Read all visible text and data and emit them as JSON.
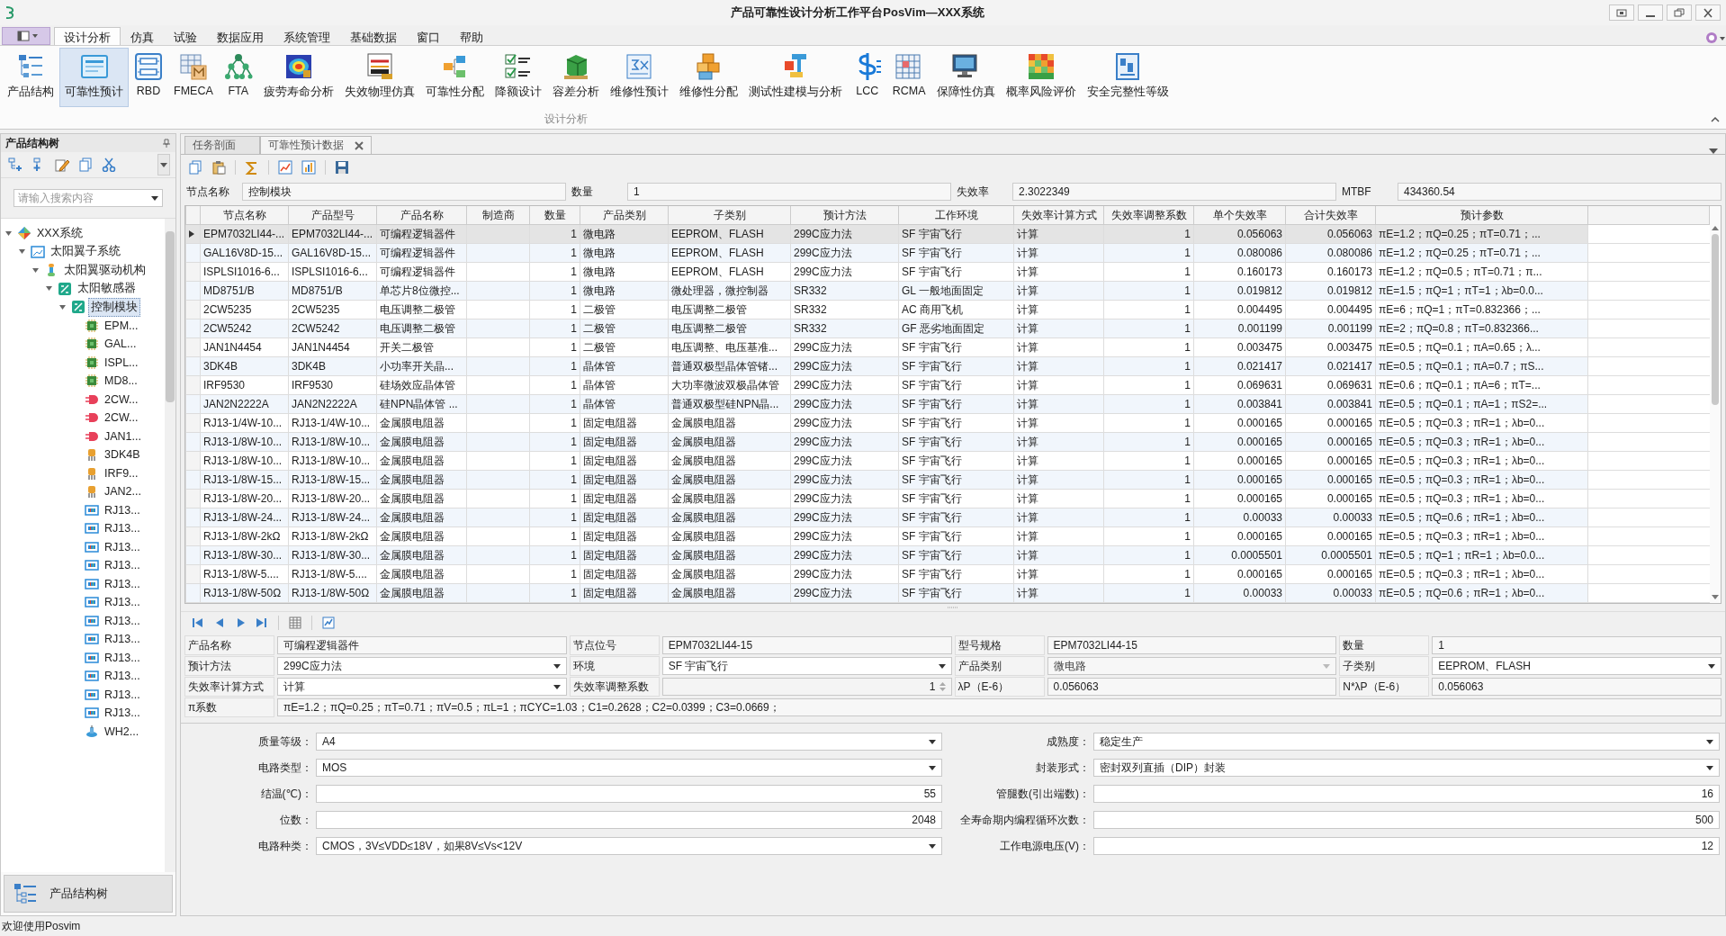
{
  "window": {
    "title": "产品可靠性设计分析工作平台PosVim—XXX系统"
  },
  "menu_tabs": [
    {
      "label": "设计分析",
      "selected": true
    },
    {
      "label": "仿真",
      "selected": false
    },
    {
      "label": "试验",
      "selected": false
    },
    {
      "label": "数据应用",
      "selected": false
    },
    {
      "label": "系统管理",
      "selected": false
    },
    {
      "label": "基础数据",
      "selected": false
    },
    {
      "label": "窗口",
      "selected": false
    },
    {
      "label": "帮助",
      "selected": false
    }
  ],
  "ribbon": {
    "group_label": "设计分析",
    "items": [
      {
        "label": "产品结构",
        "selected": false
      },
      {
        "label": "可靠性预计",
        "selected": true
      },
      {
        "label": "RBD",
        "selected": false
      },
      {
        "label": "FMECA",
        "selected": false
      },
      {
        "label": "FTA",
        "selected": false
      },
      {
        "label": "疲劳寿命分析",
        "selected": false
      },
      {
        "label": "失效物理仿真",
        "selected": false
      },
      {
        "label": "可靠性分配",
        "selected": false
      },
      {
        "label": "降额设计",
        "selected": false
      },
      {
        "label": "容差分析",
        "selected": false
      },
      {
        "label": "维修性预计",
        "selected": false
      },
      {
        "label": "维修性分配",
        "selected": false
      },
      {
        "label": "测试性建模与分析",
        "selected": false
      },
      {
        "label": "LCC",
        "selected": false
      },
      {
        "label": "RCMA",
        "selected": false
      },
      {
        "label": "保障性仿真",
        "selected": false
      },
      {
        "label": "概率风险评价",
        "selected": false
      },
      {
        "label": "安全完整性等级",
        "selected": false
      }
    ]
  },
  "tree_panel": {
    "title": "产品结构树",
    "search": {
      "placeholder": "请输入搜索内容"
    },
    "footer_button": "产品结构树",
    "tree": [
      {
        "label": "XXX系统",
        "kind": "system",
        "expanded": true,
        "selected": false,
        "children": [
          {
            "label": "太阳翼子系统",
            "kind": "subsystem",
            "expanded": true,
            "selected": false,
            "children": [
              {
                "label": "太阳翼驱动机构",
                "kind": "mechanism",
                "expanded": true,
                "selected": false,
                "children": [
                  {
                    "label": "太阳敏感器",
                    "kind": "sensor",
                    "expanded": true,
                    "selected": false,
                    "children": [
                      {
                        "label": "控制模块",
                        "kind": "module",
                        "expanded": true,
                        "selected": true,
                        "children": [
                          {
                            "label": "EPM...",
                            "kind": "chip",
                            "selected": false
                          },
                          {
                            "label": "GAL...",
                            "kind": "chip",
                            "selected": false
                          },
                          {
                            "label": "ISPL...",
                            "kind": "chip",
                            "selected": false
                          },
                          {
                            "label": "MD8...",
                            "kind": "chip",
                            "selected": false
                          },
                          {
                            "label": "2CW...",
                            "kind": "diode",
                            "selected": false
                          },
                          {
                            "label": "2CW...",
                            "kind": "diode",
                            "selected": false
                          },
                          {
                            "label": "JAN1...",
                            "kind": "diode",
                            "selected": false
                          },
                          {
                            "label": "3DK4B",
                            "kind": "transistor",
                            "selected": false
                          },
                          {
                            "label": "IRF9...",
                            "kind": "transistor",
                            "selected": false
                          },
                          {
                            "label": "JAN2...",
                            "kind": "transistor",
                            "selected": false
                          },
                          {
                            "label": "RJ13...",
                            "kind": "resistor",
                            "selected": false
                          },
                          {
                            "label": "RJ13...",
                            "kind": "resistor",
                            "selected": false
                          },
                          {
                            "label": "RJ13...",
                            "kind": "resistor",
                            "selected": false
                          },
                          {
                            "label": "RJ13...",
                            "kind": "resistor",
                            "selected": false
                          },
                          {
                            "label": "RJ13...",
                            "kind": "resistor",
                            "selected": false
                          },
                          {
                            "label": "RJ13...",
                            "kind": "resistor",
                            "selected": false
                          },
                          {
                            "label": "RJ13...",
                            "kind": "resistor",
                            "selected": false
                          },
                          {
                            "label": "RJ13...",
                            "kind": "resistor",
                            "selected": false
                          },
                          {
                            "label": "RJ13...",
                            "kind": "resistor",
                            "selected": false
                          },
                          {
                            "label": "RJ13...",
                            "kind": "resistor",
                            "selected": false
                          },
                          {
                            "label": "RJ13...",
                            "kind": "resistor",
                            "selected": false
                          },
                          {
                            "label": "RJ13...",
                            "kind": "resistor",
                            "selected": false
                          },
                          {
                            "label": "WH2...",
                            "kind": "potentiometer",
                            "selected": false
                          }
                        ]
                      }
                    ]
                  }
                ]
              }
            ]
          }
        ]
      }
    ]
  },
  "doc_tabs": [
    {
      "label": "任务剖面",
      "selected": false,
      "closable": false
    },
    {
      "label": "可靠性预计数据",
      "selected": true,
      "closable": true
    }
  ],
  "summary": [
    {
      "label": "节点名称",
      "value": "控制模块"
    },
    {
      "label": "数量",
      "value": "1"
    },
    {
      "label": "失效率",
      "value": "2.3022349"
    },
    {
      "label": "MTBF",
      "value": "434360.54"
    }
  ],
  "table": {
    "columns": [
      "节点名称",
      "产品型号",
      "产品名称",
      "制造商",
      "数量",
      "产品类别",
      "子类别",
      "预计方法",
      "工作环境",
      "失效率计算方式",
      "失效率调整系数",
      "单个失效率",
      "合计失效率",
      "预计参数"
    ],
    "rows": [
      {
        "selected": true,
        "cells": [
          "EPM7032LI44-...",
          "EPM7032LI44-...",
          "可编程逻辑器件",
          null,
          "1",
          "微电路",
          "EEPROM、FLASH",
          "299C应力法",
          "SF  宇宙飞行",
          "计算",
          "1",
          "0.056063",
          "0.056063",
          "πE=1.2；πQ=0.25；πT=0.71；..."
        ]
      },
      {
        "selected": false,
        "cells": [
          "GAL16V8D-15...",
          "GAL16V8D-15...",
          "可编程逻辑器件",
          null,
          "1",
          "微电路",
          "EEPROM、FLASH",
          "299C应力法",
          "SF  宇宙飞行",
          "计算",
          "1",
          "0.080086",
          "0.080086",
          "πE=1.2；πQ=0.25；πT=0.71；..."
        ]
      },
      {
        "selected": false,
        "cells": [
          "ISPLSI1016-6...",
          "ISPLSI1016-6...",
          "可编程逻辑器件",
          null,
          "1",
          "微电路",
          "EEPROM、FLASH",
          "299C应力法",
          "SF  宇宙飞行",
          "计算",
          "1",
          "0.160173",
          "0.160173",
          "πE=1.2；πQ=0.5；πT=0.71；π..."
        ]
      },
      {
        "selected": false,
        "cells": [
          "MD8751/B",
          "MD8751/B",
          "单芯片8位微控...",
          null,
          "1",
          "微电路",
          "微处理器，微控制器",
          "SR332",
          "GL  一般地面固定",
          "计算",
          "1",
          "0.019812",
          "0.019812",
          "πE=1.5；πQ=1；πT=1；λb=0.0..."
        ]
      },
      {
        "selected": false,
        "cells": [
          "2CW5235",
          "2CW5235",
          "电压调整二极管",
          null,
          "1",
          "二极管",
          "电压调整二极管",
          "SR332",
          "AC  商用飞机",
          "计算",
          "1",
          "0.004495",
          "0.004495",
          "πE=6；πQ=1；πT=0.832366；..."
        ]
      },
      {
        "selected": false,
        "cells": [
          "2CW5242",
          "2CW5242",
          "电压调整二极管",
          null,
          "1",
          "二极管",
          "电压调整二极管",
          "SR332",
          "GF  恶劣地面固定",
          "计算",
          "1",
          "0.001199",
          "0.001199",
          "πE=2；πQ=0.8；πT=0.832366..."
        ]
      },
      {
        "selected": false,
        "cells": [
          "JAN1N4454",
          "JAN1N4454",
          "开关二极管",
          null,
          "1",
          "二极管",
          "电压调整、电压基准...",
          "299C应力法",
          "SF  宇宙飞行",
          "计算",
          "1",
          "0.003475",
          "0.003475",
          "πE=0.5；πQ=0.1；πA=0.65；λ..."
        ]
      },
      {
        "selected": false,
        "cells": [
          "3DK4B",
          "3DK4B",
          "小功率开关晶...",
          null,
          "1",
          "晶体管",
          "普通双极型晶体管锗...",
          "299C应力法",
          "SF  宇宙飞行",
          "计算",
          "1",
          "0.021417",
          "0.021417",
          "πE=0.5；πQ=0.1；πA=0.7；πS..."
        ]
      },
      {
        "selected": false,
        "cells": [
          "IRF9530",
          "IRF9530",
          "硅场效应晶体管",
          null,
          "1",
          "晶体管",
          "大功率微波双极晶体管",
          "299C应力法",
          "SF  宇宙飞行",
          "计算",
          "1",
          "0.069631",
          "0.069631",
          "πE=0.6；πQ=0.1；πA=6；πT=..."
        ]
      },
      {
        "selected": false,
        "cells": [
          "JAN2N2222A",
          "JAN2N2222A",
          "硅NPN晶体管 ...",
          null,
          "1",
          "晶体管",
          "普通双极型硅NPN晶...",
          "299C应力法",
          "SF  宇宙飞行",
          "计算",
          "1",
          "0.003841",
          "0.003841",
          "πE=0.5；πQ=0.1；πA=1；πS2=..."
        ]
      },
      {
        "selected": false,
        "cells": [
          "RJ13-1/4W-10...",
          "RJ13-1/4W-10...",
          "金属膜电阻器",
          null,
          "1",
          "固定电阻器",
          "金属膜电阻器",
          "299C应力法",
          "SF  宇宙飞行",
          "计算",
          "1",
          "0.000165",
          "0.000165",
          "πE=0.5；πQ=0.3；πR=1；λb=0..."
        ]
      },
      {
        "selected": false,
        "cells": [
          "RJ13-1/8W-10...",
          "RJ13-1/8W-10...",
          "金属膜电阻器",
          null,
          "1",
          "固定电阻器",
          "金属膜电阻器",
          "299C应力法",
          "SF  宇宙飞行",
          "计算",
          "1",
          "0.000165",
          "0.000165",
          "πE=0.5；πQ=0.3；πR=1；λb=0..."
        ]
      },
      {
        "selected": false,
        "cells": [
          "RJ13-1/8W-10...",
          "RJ13-1/8W-10...",
          "金属膜电阻器",
          null,
          "1",
          "固定电阻器",
          "金属膜电阻器",
          "299C应力法",
          "SF  宇宙飞行",
          "计算",
          "1",
          "0.000165",
          "0.000165",
          "πE=0.5；πQ=0.3；πR=1；λb=0..."
        ]
      },
      {
        "selected": false,
        "cells": [
          "RJ13-1/8W-15...",
          "RJ13-1/8W-15...",
          "金属膜电阻器",
          null,
          "1",
          "固定电阻器",
          "金属膜电阻器",
          "299C应力法",
          "SF  宇宙飞行",
          "计算",
          "1",
          "0.000165",
          "0.000165",
          "πE=0.5；πQ=0.3；πR=1；λb=0..."
        ]
      },
      {
        "selected": false,
        "cells": [
          "RJ13-1/8W-20...",
          "RJ13-1/8W-20...",
          "金属膜电阻器",
          null,
          "1",
          "固定电阻器",
          "金属膜电阻器",
          "299C应力法",
          "SF  宇宙飞行",
          "计算",
          "1",
          "0.000165",
          "0.000165",
          "πE=0.5；πQ=0.3；πR=1；λb=0..."
        ]
      },
      {
        "selected": false,
        "cells": [
          "RJ13-1/8W-24...",
          "RJ13-1/8W-24...",
          "金属膜电阻器",
          null,
          "1",
          "固定电阻器",
          "金属膜电阻器",
          "299C应力法",
          "SF  宇宙飞行",
          "计算",
          "1",
          "0.00033",
          "0.00033",
          "πE=0.5；πQ=0.6；πR=1；λb=0..."
        ]
      },
      {
        "selected": false,
        "cells": [
          "RJ13-1/8W-2kΩ",
          "RJ13-1/8W-2kΩ",
          "金属膜电阻器",
          null,
          "1",
          "固定电阻器",
          "金属膜电阻器",
          "299C应力法",
          "SF  宇宙飞行",
          "计算",
          "1",
          "0.000165",
          "0.000165",
          "πE=0.5；πQ=0.3；πR=1；λb=0..."
        ]
      },
      {
        "selected": false,
        "cells": [
          "RJ13-1/8W-30...",
          "RJ13-1/8W-30...",
          "金属膜电阻器",
          null,
          "1",
          "固定电阻器",
          "金属膜电阻器",
          "299C应力法",
          "SF  宇宙飞行",
          "计算",
          "1",
          "0.0005501",
          "0.0005501",
          "πE=0.5；πQ=1；πR=1；λb=0.0..."
        ]
      },
      {
        "selected": false,
        "cells": [
          "RJ13-1/8W-5....",
          "RJ13-1/8W-5....",
          "金属膜电阻器",
          null,
          "1",
          "固定电阻器",
          "金属膜电阻器",
          "299C应力法",
          "SF  宇宙飞行",
          "计算",
          "1",
          "0.000165",
          "0.000165",
          "πE=0.5；πQ=0.3；πR=1；λb=0..."
        ]
      },
      {
        "selected": false,
        "cells": [
          "RJ13-1/8W-50Ω",
          "RJ13-1/8W-50Ω",
          "金属膜电阻器",
          null,
          "1",
          "固定电阻器",
          "金属膜电阻器",
          "299C应力法",
          "SF  宇宙飞行",
          "计算",
          "1",
          "0.00033",
          "0.00033",
          "πE=0.5；πQ=0.6；πR=1；λb=0..."
        ]
      }
    ]
  },
  "detail_form": {
    "rows": [
      [
        {
          "label": "产品名称",
          "value": "可编程逻辑器件",
          "kind": "text"
        },
        {
          "label": "节点位号",
          "value": "EPM7032LI44-15",
          "kind": "text"
        },
        {
          "label": "型号规格",
          "value": "EPM7032LI44-15",
          "kind": "text"
        },
        {
          "label": "数量",
          "value": "1",
          "kind": "text"
        }
      ],
      [
        {
          "label": "预计方法",
          "value": "299C应力法",
          "kind": "dropdown"
        },
        {
          "label": "环境",
          "value": "SF  宇宙飞行",
          "kind": "dropdown"
        },
        {
          "label": "产品类别",
          "value": "微电路",
          "kind": "dropdown",
          "disabled": true
        },
        {
          "label": "子类别",
          "value": "EEPROM、FLASH",
          "kind": "dropdown"
        }
      ],
      [
        {
          "label": "失效率计算方式",
          "value": "计算",
          "kind": "dropdown"
        },
        {
          "label": "失效率调整系数",
          "value": "1",
          "kind": "spin"
        },
        {
          "label": "λP（E-6）",
          "value": "0.056063",
          "kind": "text"
        },
        {
          "label": "N*λP（E-6）",
          "value": "0.056063",
          "kind": "text"
        }
      ],
      [
        {
          "label": "π系数",
          "value": "πE=1.2；πQ=0.25；πT=0.71；πV=0.5；πL=1；πCYC=1.03；C1=0.2628；C2=0.0399；C3=0.0669；",
          "kind": "wide"
        }
      ]
    ]
  },
  "parameter_form": {
    "rows": [
      [
        {
          "label": "质量等级：",
          "value": "A4",
          "kind": "dropdown"
        },
        {
          "label": "成熟度：",
          "value": "稳定生产",
          "kind": "dropdown"
        }
      ],
      [
        {
          "label": "电路类型：",
          "value": "MOS",
          "kind": "dropdown"
        },
        {
          "label": "封装形式：",
          "value": "密封双列直插（DIP）封装",
          "kind": "dropdown"
        }
      ],
      [
        {
          "label": "结温(℃)：",
          "value": "55",
          "kind": "number"
        },
        {
          "label": "管腿数(引出端数)：",
          "value": "16",
          "kind": "number"
        }
      ],
      [
        {
          "label": "位数：",
          "value": "2048",
          "kind": "number"
        },
        {
          "label": "全寿命期内编程循环次数：",
          "value": "500",
          "kind": "number"
        }
      ],
      [
        {
          "label": "电路种类：",
          "value": "CMOS，3V≤VDD≤18V，如果8V≤Vs<12V",
          "kind": "dropdown"
        },
        {
          "label": "工作电源电压(V)：",
          "value": "12",
          "kind": "number"
        }
      ]
    ]
  },
  "status_bar": "欢迎使用Posvim"
}
